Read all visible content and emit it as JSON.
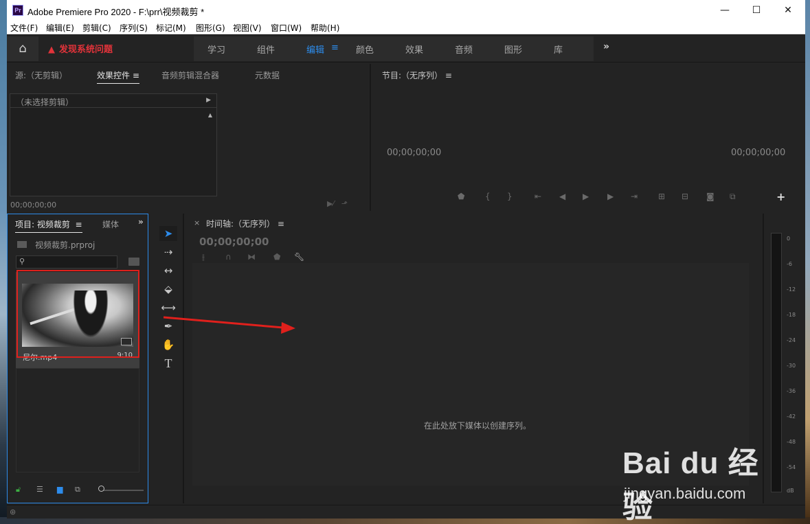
{
  "title_bar": {
    "app_icon_text": "Pr",
    "title": "Adobe Premiere Pro 2020 - F:\\prr\\视频裁剪 *",
    "minimize": "—",
    "maximize": "☐",
    "close": "✕"
  },
  "menu": [
    "文件(F)",
    "编辑(E)",
    "剪辑(C)",
    "序列(S)",
    "标记(M)",
    "图形(G)",
    "视图(V)",
    "窗口(W)",
    "帮助(H)"
  ],
  "workspace_bar": {
    "home": "⌂",
    "warning": "发现系统问题",
    "tabs": [
      "学习",
      "组件",
      "编辑",
      "颜色",
      "效果",
      "音频",
      "图形",
      "库"
    ],
    "active_tab": "编辑",
    "menu_glyph": "≡",
    "more": "»"
  },
  "source_panel": {
    "tabs": [
      "源:（无剪辑）",
      "效果控件",
      "音频剪辑混合器",
      "元数据"
    ],
    "active_tab": "效果控件",
    "tab_menu": "≡",
    "no_clip_selected": "（未选择剪辑）",
    "timecode": "00;00;00;00"
  },
  "program_panel": {
    "title": "节目:（无序列）",
    "title_menu": "≡",
    "timecode_left": "00;00;00;00",
    "timecode_right": "00;00;00;00",
    "add_button": "+"
  },
  "project_panel": {
    "tabs": [
      "项目: 视频裁剪",
      "媒体"
    ],
    "active_tab": "项目: 视频裁剪",
    "tab_menu": "≡",
    "more": "»",
    "project_file": "视频裁剪.prproj",
    "search_placeholder": "",
    "clip": {
      "name": "尼尔.mp4",
      "duration": "9:10"
    }
  },
  "timeline_panel": {
    "close": "×",
    "title": "时间轴:（无序列）",
    "title_menu": "≡",
    "timecode": "00;00;00;00",
    "drop_hint": "在此处放下媒体以创建序列。"
  },
  "audio_meter": {
    "labels": [
      "0",
      "-6",
      "-12",
      "-18",
      "-24",
      "-30",
      "-36",
      "-42",
      "-48",
      "-54",
      "dB"
    ]
  },
  "annotation": {
    "color": "#e0201c"
  },
  "watermark": {
    "logo": "Bai du 经验",
    "url": "jingyan.baidu.com"
  },
  "colors": {
    "accent": "#2d8ceb",
    "warning": "#e1333a",
    "panel_bg": "#232323"
  }
}
